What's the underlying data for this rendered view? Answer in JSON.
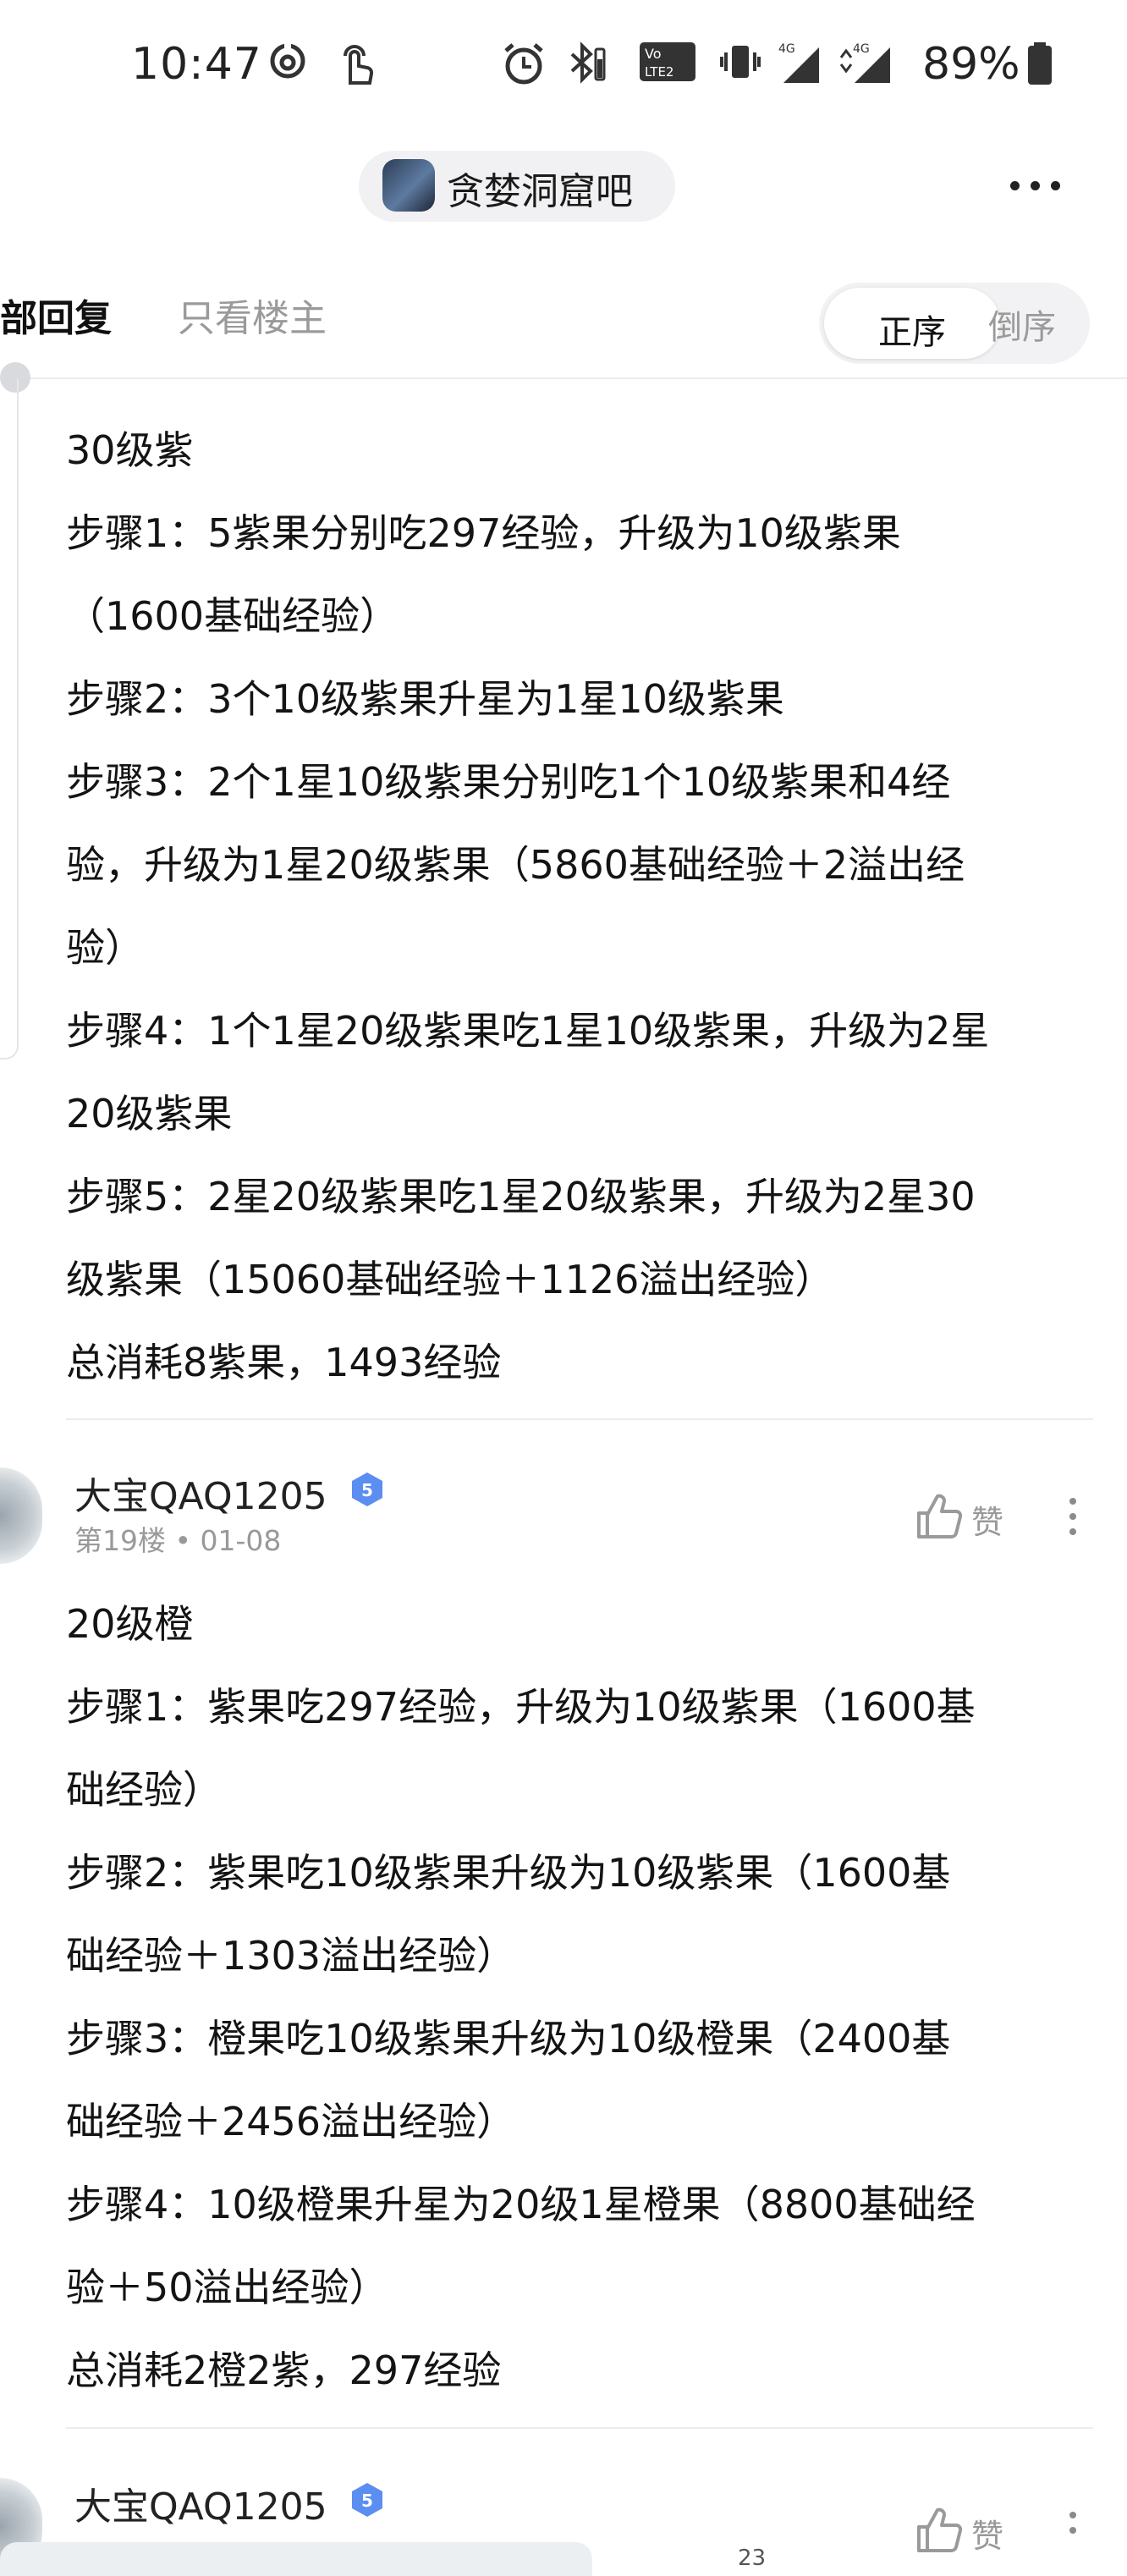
{
  "status_bar": {
    "time": "10:47",
    "battery": "89%",
    "icons": [
      "hotspot-icon",
      "touch-icon",
      "alarm-icon",
      "bluetooth-icon",
      "volte-icon",
      "vibrate-icon",
      "signal-4g-icon",
      "signal-4g-icon",
      "battery-icon"
    ]
  },
  "header": {
    "forum_name": "贪婪洞窟吧"
  },
  "tabs": {
    "all_replies": "部回复",
    "only_owner": "只看楼主",
    "sort_asc": "正序",
    "sort_desc": "倒序"
  },
  "posts": [
    {
      "lines": [
        "30级紫",
        "步骤1：5紫果分别吃297经验，升级为10级紫果",
        "（1600基础经验）",
        "步骤2：3个10级紫果升星为1星10级紫果",
        "步骤3：2个1星10级紫果分别吃1个10级紫果和4经",
        "验，升级为1星20级紫果（5860基础经验＋2溢出经",
        "验）",
        "步骤4：1个1星20级紫果吃1星10级紫果，升级为2星",
        "20级紫果",
        "步骤5：2星20级紫果吃1星20级紫果，升级为2星30",
        "级紫果（15060基础经验＋1126溢出经验）",
        "总消耗8紫果，1493经验"
      ]
    },
    {
      "author": "大宝QAQ1205",
      "level": "5",
      "floor": "第19楼",
      "date": "01-08",
      "like_label": "赞",
      "lines": [
        "20级橙",
        "步骤1：紫果吃297经验，升级为10级紫果（1600基",
        "础经验）",
        "步骤2：紫果吃10级紫果升级为10级紫果（1600基",
        "础经验＋1303溢出经验）",
        "步骤3：橙果吃10级紫果升级为10级橙果（2400基",
        "础经验＋2456溢出经验）",
        "步骤4：10级橙果升星为20级1星橙果（8800基础经",
        "验＋50溢出经验）",
        "总消耗2橙2紫，297经验"
      ]
    },
    {
      "author": "大宝QAQ1205",
      "level": "5",
      "like_label": "赞"
    }
  ],
  "footer": {
    "page_number": "23"
  },
  "colors": {
    "badge_blue": "#5b8ef0",
    "meta_gray": "#999999",
    "divider": "#ececec"
  }
}
